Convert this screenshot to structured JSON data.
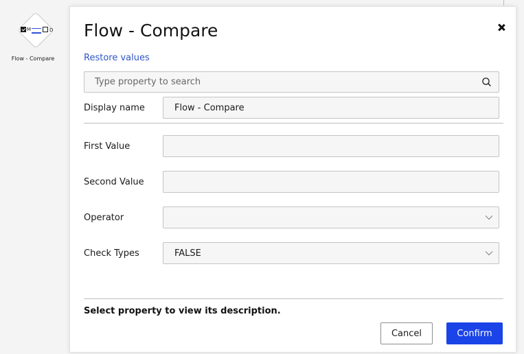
{
  "canvas": {
    "node": {
      "label": "Flow - Compare",
      "glyph_m": "M",
      "glyph_d": "D",
      "icon": "compare-node-icon"
    }
  },
  "dialog": {
    "title": "Flow - Compare",
    "close_icon": "close-icon",
    "restore_label": "Restore values",
    "search": {
      "placeholder": "Type property to search",
      "value": "",
      "icon": "search-icon"
    },
    "display_name": {
      "label": "Display name",
      "value": "Flow - Compare"
    },
    "properties": [
      {
        "label": "First Value",
        "value": "",
        "type": "text"
      },
      {
        "label": "Second Value",
        "value": "",
        "type": "text"
      },
      {
        "label": "Operator",
        "value": "",
        "type": "select"
      },
      {
        "label": "Check Types",
        "value": "FALSE",
        "type": "select"
      }
    ],
    "description": "Select property to view its description.",
    "buttons": {
      "cancel_label": "Cancel",
      "confirm_label": "Confirm"
    },
    "colors": {
      "accent": "#1a44e8",
      "link": "#2e55c7",
      "field_bg": "#f6f6f6",
      "border": "#c4c4c4"
    }
  }
}
